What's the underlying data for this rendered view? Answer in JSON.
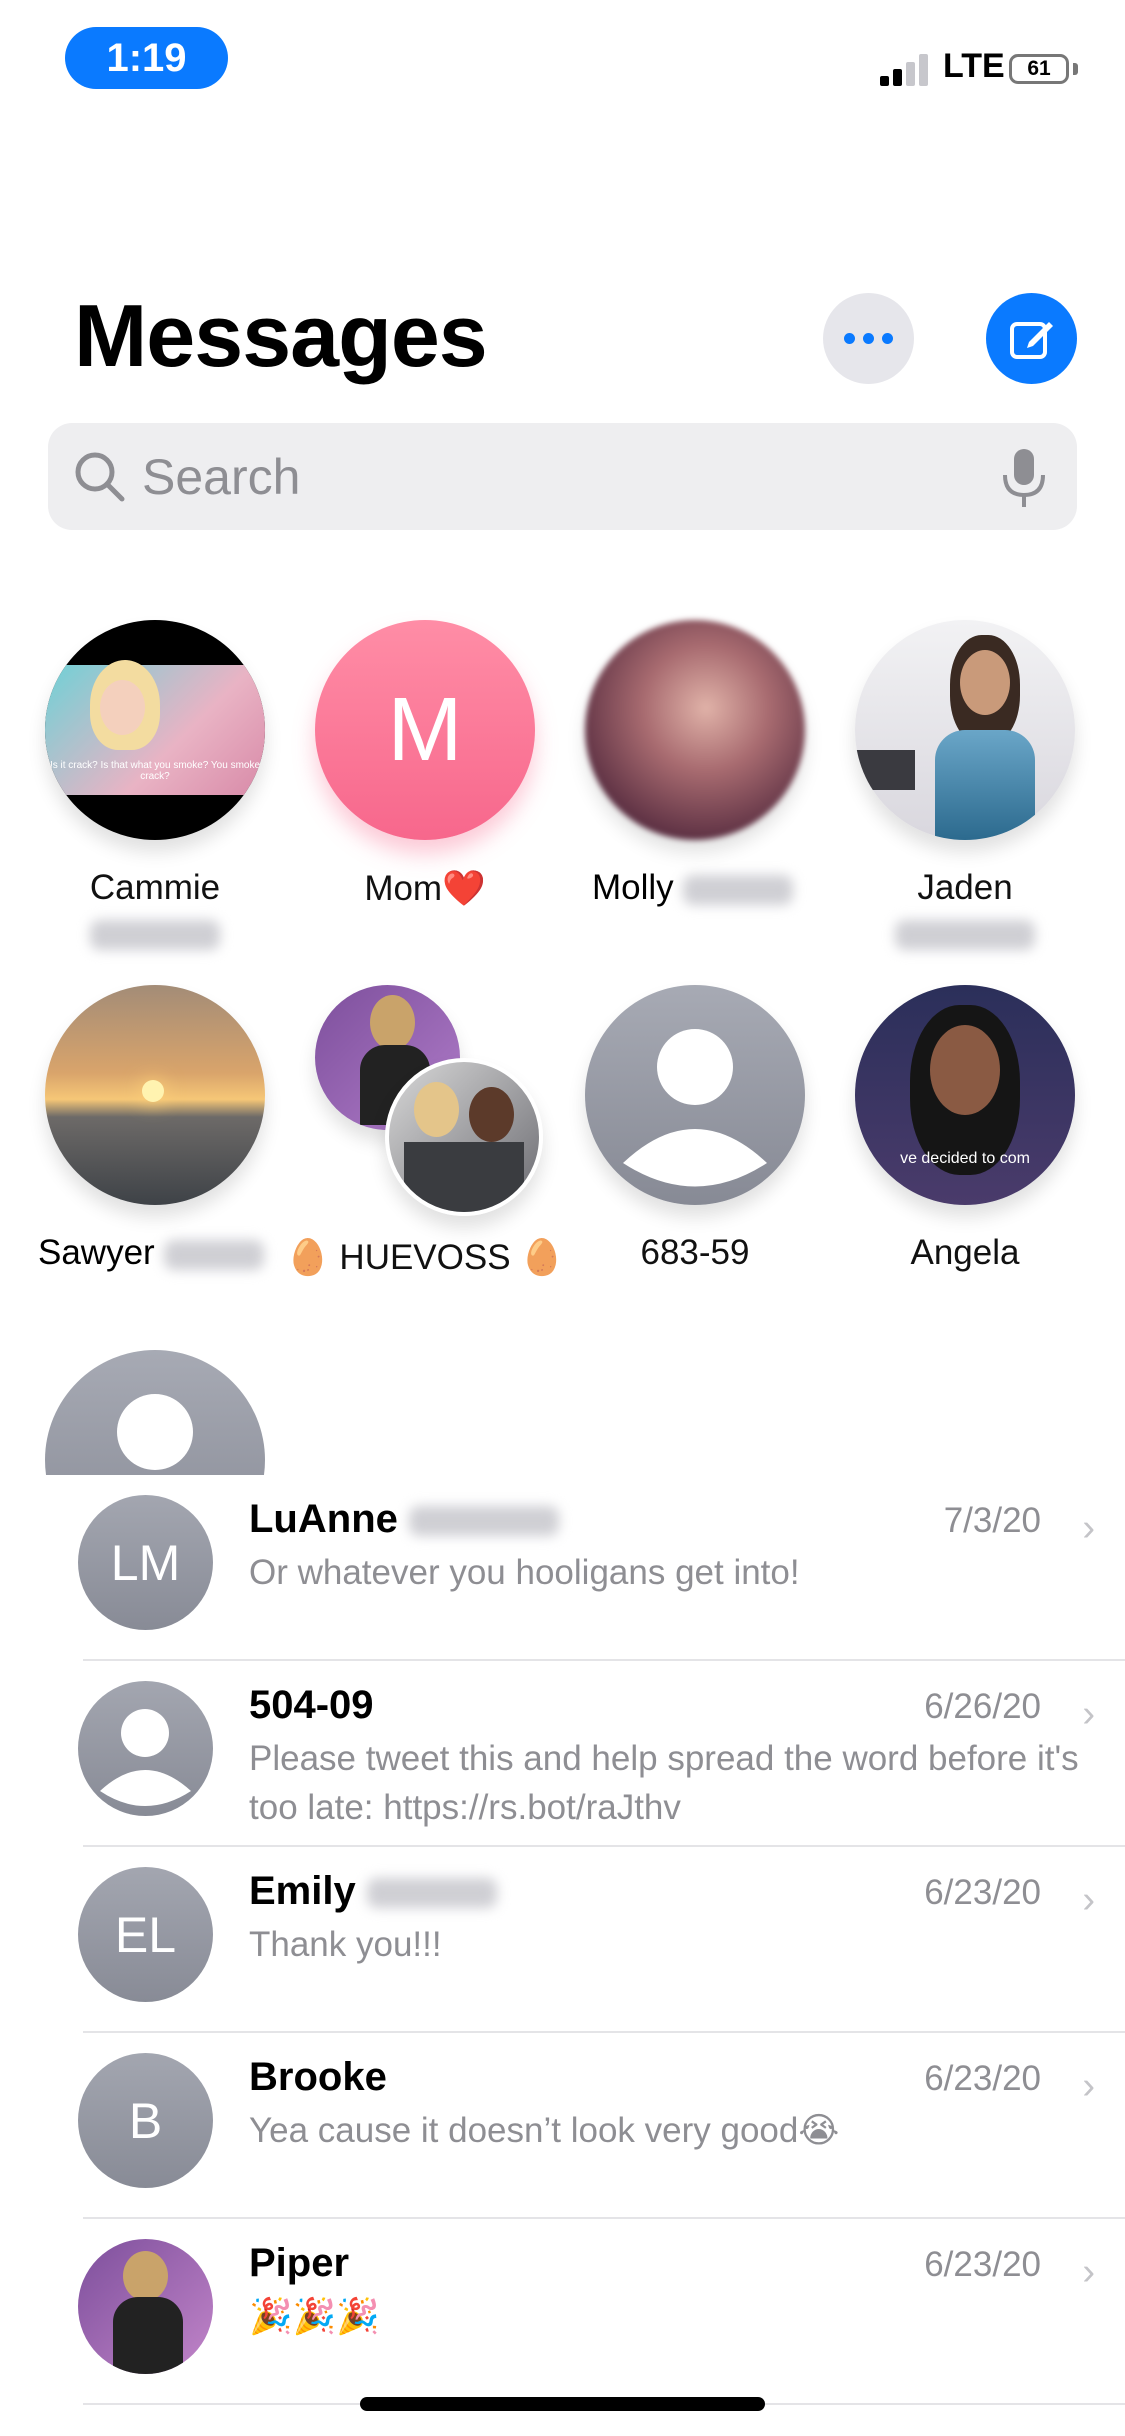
{
  "status_bar": {
    "time": "1:19",
    "network": "LTE",
    "battery": "61"
  },
  "header": {
    "title": "Messages",
    "more_icon": "ellipsis-icon",
    "compose_icon": "compose-icon"
  },
  "search": {
    "placeholder": "Search"
  },
  "pinned": [
    {
      "name": "Cammie",
      "caption": "Is it crack? Is that what you smoke? You smoke crack?"
    },
    {
      "name": "Mom❤️",
      "initial": "M"
    },
    {
      "name": "Molly"
    },
    {
      "name": "Jaden"
    },
    {
      "name": "Sawyer"
    },
    {
      "name": "🥚 HUEVOSS 🥚"
    },
    {
      "name": "683-59"
    },
    {
      "name": "Angela",
      "caption": "ve decided to com"
    }
  ],
  "conversations": [
    {
      "name": "LuAnne",
      "initials": "LM",
      "date": "7/3/20",
      "preview": "Or whatever you hooligans get into!"
    },
    {
      "name": "504-09",
      "initials": "",
      "date": "6/26/20",
      "preview": "Please tweet this and help spread the word before it's too late: https://rs.bot/raJthv"
    },
    {
      "name": "Emily",
      "initials": "EL",
      "date": "6/23/20",
      "preview": "Thank you!!!"
    },
    {
      "name": "Brooke",
      "initials": "B",
      "date": "6/23/20",
      "preview": "Yea cause it doesn’t look very good😭"
    },
    {
      "name": "Piper",
      "initials": "",
      "date": "6/23/20",
      "preview": "🎉🎉🎉"
    }
  ],
  "chevron": "›"
}
